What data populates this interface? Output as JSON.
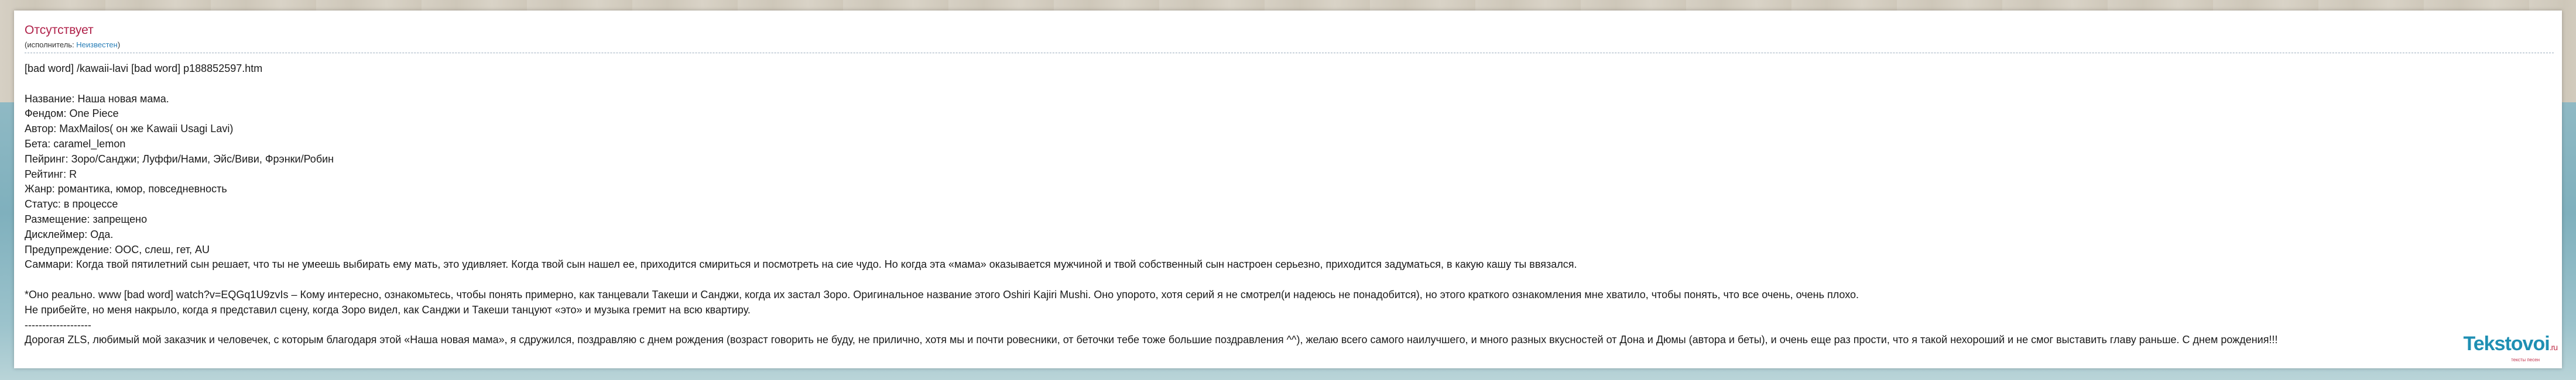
{
  "song": {
    "title": "Отсутствует",
    "performer_prefix": "(исполнитель: ",
    "performer_name": "Неизвестен",
    "performer_suffix": ")"
  },
  "lines": [
    "[bad word] /kawaii-lavi [bad word] p188852597.htm",
    "",
    "Название: Наша новая мама.",
    "Фендом: One Piece",
    "Автор: MaxMailos( он же Kawaii Usagi Lavi)",
    "Бета: caramel_lemon",
    "Пейринг: Зоро/Санджи; Луффи/Нами, Эйс/Виви, Фрэнки/Робин",
    "Рейтинг: R",
    "Жанр: романтика, юмор, повседневность",
    "Статус: в процессе",
    "Размещение: запрещено",
    "Дисклеймер: Ода.",
    "Предупреждение: ООС, слеш, гет, AU",
    "Саммари: Когда твой пятилетний сын решает, что ты не умеешь выбирать ему мать, это удивляет. Когда твой сын нашел ее, приходится смириться и посмотреть на сие чудо. Но когда эта «мама» оказывается мужчиной и твой собственный сын настроен серьезно, приходится задуматься, в какую кашу ты ввязался.",
    "",
    "*Оно реально. www [bad word] watch?v=EQGq1U9zvIs – Кому интересно, ознакомьтесь, чтобы понять примерно, как танцевали Такеши и Санджи, когда их застал Зоро. Оригинальное название этого Oshiri Kajiri Mushi. Оно упорото, хотя серий я не смотрел(и надеюсь не понадобится), но этого краткого ознакомления мне хватило, чтобы понять, что все очень, очень плохо.",
    "Не прибейте, но меня накрыло, когда я представил сцену, когда Зоро видел, как Санджи и Такеши танцуют «это» и музыка гремит на всю квартиру.",
    "-------------------",
    "Дорогая ZLS, любимый мой заказчик и человечек, с которым благодаря этой «Наша новая мама», я сдружился, поздравляю с днем рождения (возраст говорить не буду, не прилично, хотя мы и почти ровесники, от беточки тебе тоже большие поздравления ^^), желаю всего самого наилучшего, и много разных вкусностей от Дона и Дюмы (автора и беты), и очень еще раз прости, что я такой нехороший и не смог выставить главу раньше. С днем рождения!!!"
  ],
  "logo": {
    "name": "Tekstovoi",
    "tld": ".ru",
    "tagline": "тексты песен"
  }
}
